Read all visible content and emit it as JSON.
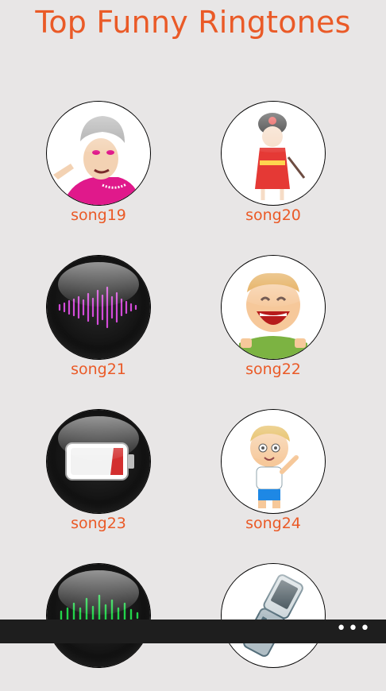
{
  "header": {
    "title": "Top Funny Ringtones"
  },
  "songs": [
    {
      "label": "song19",
      "icon": "old-lady-icon"
    },
    {
      "label": "song20",
      "icon": "geisha-girl-icon"
    },
    {
      "label": "song21",
      "icon": "purple-soundwave-icon"
    },
    {
      "label": "song22",
      "icon": "laughing-boy-icon"
    },
    {
      "label": "song23",
      "icon": "low-battery-icon"
    },
    {
      "label": "song24",
      "icon": "waving-boy-icon"
    },
    {
      "label": "",
      "icon": "green-soundwave-icon"
    },
    {
      "label": "",
      "icon": "flip-phone-icon"
    }
  ],
  "appbar": {
    "more_label": "•••"
  },
  "colors": {
    "accent": "#ea5a27",
    "background": "#e8e6e6",
    "appbar": "#1e1e1e"
  }
}
